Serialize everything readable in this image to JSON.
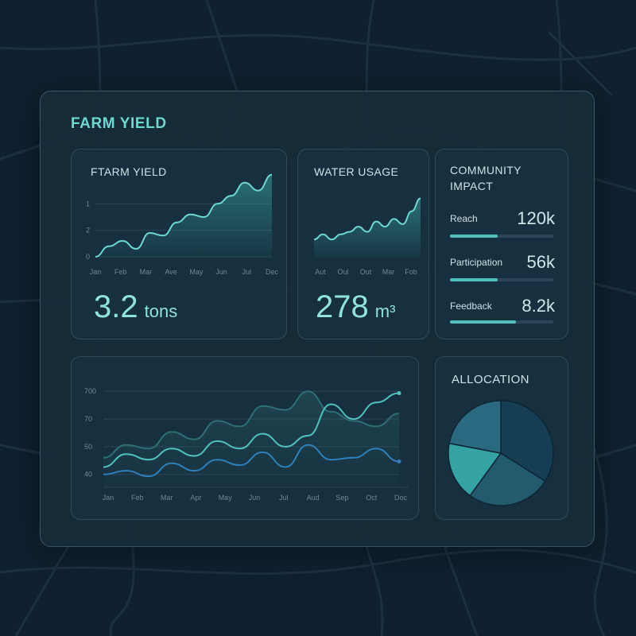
{
  "page": {
    "title": "FARM YIELD"
  },
  "colors": {
    "accent": "#6fd6d0",
    "teal": "#52c0bd",
    "blue": "#2f7fb8",
    "dark_teal": "#2f6f73"
  },
  "farm_card": {
    "title": "FTARM YIELD",
    "value": "3.2",
    "unit": "tons"
  },
  "water_card": {
    "title": "WATER USAGE",
    "value": "278",
    "unit": "m³"
  },
  "community": {
    "title_line1": "COMMUNITY",
    "title_line2": "IMPACT",
    "metrics": [
      {
        "label": "Reach",
        "value": "120k",
        "progress": 0.46
      },
      {
        "label": "Participation",
        "value": "56k",
        "progress": 0.46
      },
      {
        "label": "Feedback",
        "value": "8.2k",
        "progress": 0.64
      }
    ]
  },
  "allocation": {
    "title": "ALLOCATION"
  },
  "chart_data": [
    {
      "type": "area",
      "title": "FTARM YIELD",
      "categories": [
        "Jan",
        "Feb",
        "Mar",
        "Ave",
        "May",
        "Jun",
        "Jul",
        "Dec"
      ],
      "y_ticks": [
        "0",
        "2",
        "1"
      ],
      "y_range": [
        0,
        3
      ],
      "series": [
        {
          "values": [
            0.0,
            0.4,
            0.6,
            0.3,
            0.9,
            0.8,
            1.3,
            1.6,
            1.5,
            2.0,
            2.3,
            2.8,
            2.5,
            3.1
          ]
        }
      ],
      "grid": true
    },
    {
      "type": "area",
      "title": "WATER USAGE",
      "categories": [
        "Aut",
        "Oul",
        "Out",
        "Mar",
        "Fob"
      ],
      "series": [
        {
          "values": [
            0.7,
            0.9,
            0.7,
            0.9,
            1.0,
            1.2,
            1.0,
            1.4,
            1.2,
            1.5,
            1.3,
            1.8,
            2.3
          ]
        }
      ],
      "y_range": [
        0,
        2.5
      ],
      "grid": false
    },
    {
      "type": "line",
      "categories": [
        "Jan",
        "Feb",
        "Mar",
        "Apr",
        "May",
        "Jun",
        "Jul",
        "Aud",
        "Sep",
        "Oct",
        "Doc"
      ],
      "y_ticks": [
        "40",
        "50",
        "70",
        "700"
      ],
      "y_tick_values": [
        40,
        55,
        70,
        85
      ],
      "y_range": [
        33,
        95
      ],
      "grid": true,
      "series": [
        {
          "color": "#2f6f73",
          "values": [
            49,
            56,
            54,
            63,
            59,
            69,
            66,
            77,
            75,
            85,
            74,
            69,
            66,
            73
          ]
        },
        {
          "color": "#52c0bd",
          "values": [
            44,
            51,
            48,
            54,
            50,
            58,
            54,
            62,
            55,
            61,
            78,
            70,
            79,
            84
          ]
        },
        {
          "color": "#2f7fb8",
          "values": [
            40,
            42,
            39,
            46,
            42,
            48,
            45,
            52,
            44,
            56,
            48,
            49,
            54,
            47
          ]
        }
      ]
    },
    {
      "type": "pie",
      "title": "ALLOCATION",
      "series": [
        {
          "values": [
            34,
            26,
            18,
            22
          ]
        }
      ],
      "colors": [
        "#153e54",
        "#245a6e",
        "#35a2a3",
        "#2b6980"
      ]
    }
  ]
}
